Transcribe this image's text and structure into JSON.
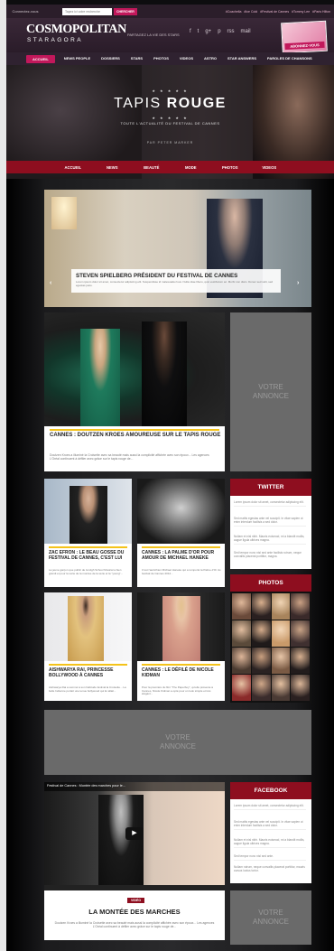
{
  "topbar": {
    "connect": "Connectez-vous",
    "search_placeholder": "Tapez ici votre recherche",
    "search_button": "CHERCHER",
    "tags": [
      "#Coachella",
      "#Ice Cold",
      "#Festival de Cannes",
      "#Tommy Lee",
      "#Paris Hilton"
    ]
  },
  "header": {
    "logo": "COSMOPOLITAN",
    "logo_sub": "STARAGORA",
    "follow": "PARTAGEZ LA VIE DES STARS",
    "socials": [
      "f",
      "t",
      "g+",
      "p",
      "rss",
      "mail"
    ],
    "promo": "ABONNEZ-VOUS"
  },
  "nav": {
    "items": [
      "ACCUEIL",
      "NEWS PEOPLE",
      "DOSSIERS",
      "STARS",
      "PHOTOS",
      "VIDEOS",
      "ASTRO",
      "STAR ANSWERS",
      "PAROLES DE CHANSONS"
    ]
  },
  "hero": {
    "stars": "★ ★ ★ ★ ★",
    "title_a": "TAPIS ",
    "title_b": "ROUGE",
    "subtitle": "TOUTE L'ACTUALITÉ DU FESTIVAL DE CANNES",
    "credit": "PAR PETER MARKER",
    "subnav": [
      "ACCUEIL",
      "NEWS",
      "BEAUTÉ",
      "MODE",
      "PHOTOS",
      "VIDEOS"
    ]
  },
  "featured": {
    "title": "STEVEN SPIELBERG PRÉSIDENT DU FESTIVAL DE CANNES",
    "text": "Lorem ipsum dolor sit amet, consectetur adipiscing elit. Suspendisse id malesuada risus. Nulla vitae libero, quis vestibulum ac. Morbi non diam. Donec sed velit, sed egestas justo."
  },
  "articles": [
    {
      "title": "CANNES : DOUTZEN KROES AMOUREUSE SUR LE TAPIS ROUGE",
      "text": "Doutzen Kroes a illuminé la Croisette avec sa beauté mais aussi la complicité affichée avec son époux... Les agences L'Oréal continuent à défiler avec grâce sur le tapis rouge de..."
    },
    {
      "title": "ZAC EFRON : LE BEAU GOSSE DU FESTIVAL DE CANNES, C'EST LUI",
      "text": "La jeune garçon que public de la High School Musical a bien grandi et pour la sorte de la montée de la série et la \"young\"..."
    },
    {
      "title": "CANNES : LA PALME D'OR POUR AMOUR DE MICHAEL HANEKE",
      "text": "C'est l'autrichien Michael Haneke qui a remporté la Palme d'Or du festival de Cannes 2012..."
    },
    {
      "title": "AISHWARYA RAI, PRINCESSE BOLLYWOOD À CANNES",
      "text": "Aishwarya Rai a sommé à son habitude festival la Croisette... La belle Indienne portait une tenue bollywood qui lui allait..."
    },
    {
      "title": "CANNES : LE DÉFILÉ DE NICOLE KIDMAN",
      "text": "Pour la première du film \"The Paperboy\", qu'elle présente à Cannes, Nicole Kidman a opté pour un look simple et très élégant..."
    }
  ],
  "ads": {
    "label_1": "VOTRE",
    "label_2": "ANNONCE"
  },
  "sidebar": {
    "twitter": "TWITTER",
    "twitter_lines": [
      "Lorem ipsum dolor sit amet, consectetur adipiscing elit.",
      "Sed mattis egestas ante vel suscipit. In vitae sapien ut enim interdum facilisis a sed dolor.",
      "Nullam et nisl nibh. Mauris euismod, mi a blandit mollis, augue ligula ultrices magna.",
      "Sed tempor nunc nisl sed ante facilisis rutrum, neque convallis placerat porttitor, magna."
    ],
    "photos": "PHOTOS",
    "facebook": "FACEBOOK",
    "facebook_lines": [
      "Lorem ipsum dolor sit amet, consectetur adipiscing elit.",
      "Sed mattis egestas ante vel suscipit. In vitae sapien ut enim interdum facilisis a sed dolor.",
      "Nullam et nisl nibh. Mauris euismod, mi a blandit mollis, augue ligula ultrices magna.",
      "Sed tempor nunc nisl sed ante.",
      "Nullam rutrum, neque convallis placerat porttitor, mauris cursus luctus tortor."
    ]
  },
  "video": {
    "caption": "Festival de Cannes : Montée des marches pour le...",
    "tag": "VIDÉO",
    "title": "LA MONTÉE DES MARCHES",
    "text": "Doutzen Kroes a illuminé la Croisette avec sa beauté mais aussi la complicité affichée avec son époux... Les agences L'Oréal continuent à défiler avec grâce sur le tapis rouge de..."
  },
  "colors": {
    "brand": "#c2185b",
    "red": "#8e0e1f",
    "accent": "#f4c31a"
  }
}
